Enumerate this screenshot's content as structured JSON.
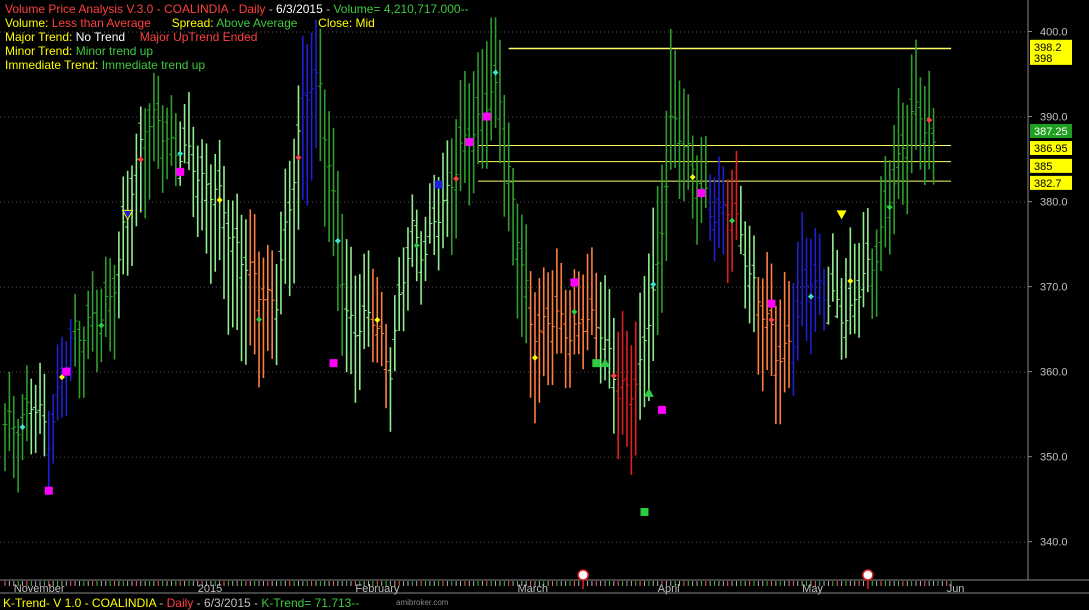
{
  "header": {
    "line1": {
      "title": "Volume Price Analysis V.3.0 - COALINDIA",
      "period": "Daily",
      "date": "6/3/2015",
      "volume": "Volume= 4,210,717.000--"
    },
    "line2": {
      "volume_label": "Volume:",
      "volume_value": "Less than Average",
      "spread_label": "Spread:",
      "spread_value": "Above Average",
      "close_label": "Close:",
      "close_value": "Mid"
    },
    "line3": {
      "label": "Major Trend:",
      "value": "No Trend",
      "extra": "Major UpTrend Ended"
    },
    "line4": {
      "label": "Minor Trend:",
      "value": "Minor trend up"
    },
    "line5": {
      "label": "Immediate Trend:",
      "value": "Immediate trend up"
    }
  },
  "footer": {
    "title": "K-Trend- V 1.0 - COALINDIA",
    "period": "Daily",
    "date": "6/3/2015",
    "ktrend": "K-Trend= 71.713--",
    "watermark": "amibroker.com"
  },
  "colors": {
    "bg": "#000000",
    "up_green": "#2e9e2e",
    "light_green": "#90ee90",
    "blue": "#1f1fd6",
    "orange": "#ff7f3f",
    "red": "#e02020",
    "yellow": "#ffff00",
    "magenta": "#ff00ff",
    "cyan": "#40e0d0",
    "price_box": "#ffff00",
    "last_box": "#1f9e1f"
  },
  "chart_data": {
    "type": "ohlc",
    "symbol": "COALINDIA",
    "ylim": [
      335.5,
      403
    ],
    "y_ticks": [
      400,
      390,
      380,
      370,
      360,
      350,
      340
    ],
    "y_tick_labels": [
      "400.0",
      "390.0",
      "380.0",
      "370.0",
      "360.0",
      "350.0",
      "340.0"
    ],
    "x_labels": [
      {
        "label": "November",
        "bar": 2
      },
      {
        "label": "2015",
        "bar": 44
      },
      {
        "label": "February",
        "bar": 80
      },
      {
        "label": "March",
        "bar": 117
      },
      {
        "label": "April",
        "bar": 149
      },
      {
        "label": "May",
        "bar": 182
      },
      {
        "label": "Jun",
        "bar": 215
      }
    ],
    "price_labels": [
      {
        "label": "398.2",
        "value": 398.2,
        "style": "yellow"
      },
      {
        "label": "398",
        "value": 396.9,
        "style": "yellow"
      },
      {
        "label": "387.25",
        "value": 388.3,
        "style": "green"
      },
      {
        "label": "386.95",
        "value": 386.3,
        "style": "yellow"
      },
      {
        "label": "385",
        "value": 384.2,
        "style": "yellow"
      },
      {
        "label": "382.7",
        "value": 382.2,
        "style": "yellow"
      }
    ],
    "levels": [
      {
        "value": 398.0,
        "from_bar": 115,
        "to_bar": 216
      },
      {
        "value": 386.6,
        "from_bar": 108,
        "to_bar": 216
      },
      {
        "value": 384.7,
        "from_bar": 108,
        "to_bar": 216
      },
      {
        "value": 382.4,
        "from_bar": 108,
        "to_bar": 216
      }
    ],
    "bar_keyframes": [
      [
        0,
        347,
        353,
        355,
        "G"
      ],
      [
        6,
        351,
        356,
        358,
        "L"
      ],
      [
        10,
        349,
        353,
        357,
        "B"
      ],
      [
        16,
        359,
        365,
        366,
        "G"
      ],
      [
        22,
        361,
        366,
        369,
        "G"
      ],
      [
        26,
        366,
        373,
        376,
        "L"
      ],
      [
        32,
        381,
        390,
        392,
        "G"
      ],
      [
        40,
        384,
        386,
        390,
        "L"
      ],
      [
        48,
        371,
        381,
        384,
        "L"
      ],
      [
        56,
        360,
        371,
        376,
        "O"
      ],
      [
        62,
        362,
        368,
        372,
        "L"
      ],
      [
        68,
        379,
        392,
        397,
        "B"
      ],
      [
        72,
        385,
        394,
        399,
        "G"
      ],
      [
        78,
        358,
        366,
        373,
        "L"
      ],
      [
        84,
        362,
        366,
        371,
        "O"
      ],
      [
        88,
        356,
        361,
        364,
        "L"
      ],
      [
        93,
        371,
        377,
        379,
        "L"
      ],
      [
        96,
        371,
        374,
        377,
        "L"
      ],
      [
        102,
        376,
        383,
        388,
        "G"
      ],
      [
        110,
        386,
        392,
        399,
        "G"
      ],
      [
        113,
        385,
        392,
        398,
        "G"
      ],
      [
        116,
        372,
        380,
        383,
        "G"
      ],
      [
        120,
        356,
        365,
        370,
        "O"
      ],
      [
        124,
        359,
        366,
        371,
        "O"
      ],
      [
        130,
        361,
        365,
        370,
        "O"
      ],
      [
        136,
        362,
        366,
        372,
        "L"
      ],
      [
        140,
        350,
        357,
        363,
        "R"
      ],
      [
        145,
        352,
        360,
        366,
        "L"
      ],
      [
        149,
        363,
        372,
        380,
        "G"
      ],
      [
        152,
        382,
        389,
        397,
        "G"
      ],
      [
        156,
        380,
        386,
        390,
        "G"
      ],
      [
        161,
        375,
        378,
        382,
        "B"
      ],
      [
        165,
        373,
        380,
        384,
        "R"
      ],
      [
        168,
        372,
        375,
        380,
        "L"
      ],
      [
        172,
        361,
        369,
        372,
        "O"
      ],
      [
        176,
        355,
        362,
        368,
        "O"
      ],
      [
        180,
        359,
        364,
        371,
        "B"
      ],
      [
        184,
        365,
        372,
        377,
        "B"
      ],
      [
        188,
        366,
        368,
        371,
        "L"
      ],
      [
        193,
        363,
        367,
        374,
        "L"
      ],
      [
        198,
        368,
        373,
        376,
        "G"
      ],
      [
        203,
        376,
        382,
        387,
        "G"
      ],
      [
        207,
        384,
        391,
        396,
        "G"
      ],
      [
        212,
        382,
        387,
        391,
        "G"
      ]
    ],
    "markers": [
      {
        "bar": 10,
        "value": 346,
        "shape": "square",
        "color": "magenta"
      },
      {
        "bar": 14,
        "value": 360,
        "shape": "square",
        "color": "magenta"
      },
      {
        "bar": 28,
        "value": 378.5,
        "shape": "down-triangle",
        "color": "blue"
      },
      {
        "bar": 40,
        "value": 383.5,
        "shape": "square",
        "color": "magenta"
      },
      {
        "bar": 75,
        "value": 361,
        "shape": "square",
        "color": "magenta"
      },
      {
        "bar": 99,
        "value": 382,
        "shape": "square",
        "color": "blue"
      },
      {
        "bar": 106,
        "value": 387,
        "shape": "square",
        "color": "magenta"
      },
      {
        "bar": 110,
        "value": 390,
        "shape": "square",
        "color": "magenta"
      },
      {
        "bar": 130,
        "value": 370.5,
        "shape": "square",
        "color": "magenta"
      },
      {
        "bar": 135,
        "value": 361,
        "shape": "square",
        "color": "green"
      },
      {
        "bar": 137,
        "value": 361,
        "shape": "up-triangle",
        "color": "green"
      },
      {
        "bar": 146,
        "value": 343.5,
        "shape": "square",
        "color": "green"
      },
      {
        "bar": 147,
        "value": 357.5,
        "shape": "up-triangle",
        "color": "green"
      },
      {
        "bar": 150,
        "value": 355.5,
        "shape": "square",
        "color": "magenta"
      },
      {
        "bar": 159,
        "value": 381,
        "shape": "square",
        "color": "magenta"
      },
      {
        "bar": 175,
        "value": 368,
        "shape": "square",
        "color": "magenta"
      },
      {
        "bar": 191,
        "value": 378.5,
        "shape": "down-triangle",
        "color": "yellow"
      }
    ]
  }
}
